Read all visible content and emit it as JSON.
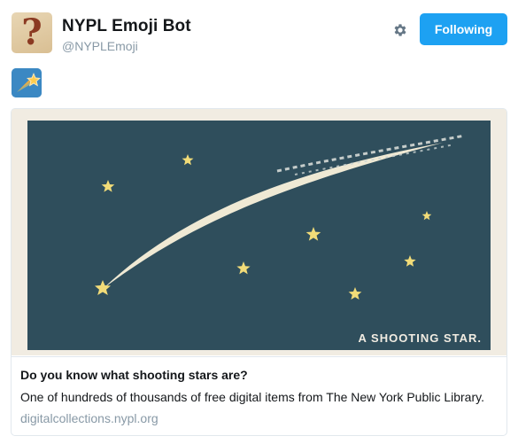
{
  "profile": {
    "name": "NYPL Emoji Bot",
    "handle": "@NYPLEmoji",
    "avatar_glyph": "?",
    "avatar_icon": "question-mark-avatar"
  },
  "actions": {
    "follow_label": "Following",
    "settings_icon": "gear-icon",
    "accent": "#1da1f2"
  },
  "tweet": {
    "emoji_icon": "shooting-star-emoji-icon"
  },
  "card": {
    "image_caption": "A SHOOTING STAR.",
    "title": "Do you know what shooting stars are?",
    "description": "One of hundreds of thousands of free digital items from The New York Public Library.",
    "domain": "digitalcollections.nypl.org"
  },
  "colors": {
    "image_sky": "#2f4e5c",
    "image_frame": "#f1ece2",
    "star": "#f2dc78",
    "muted_text": "#8899a6"
  }
}
